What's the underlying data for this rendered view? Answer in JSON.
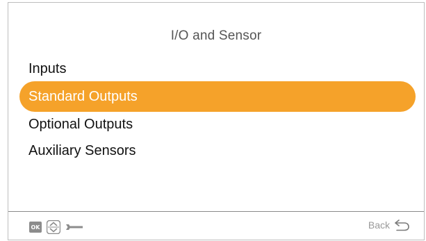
{
  "header": {
    "title": "I/O and Sensor"
  },
  "menu": {
    "items": [
      {
        "label": "Inputs",
        "selected": false
      },
      {
        "label": "Standard Outputs",
        "selected": true
      },
      {
        "label": "Optional Outputs",
        "selected": false
      },
      {
        "label": "Auxiliary Sensors",
        "selected": false
      }
    ]
  },
  "footer": {
    "ok_label": "OK",
    "back_label": "Back",
    "icons": [
      "ok-icon",
      "up-down-arrows-icon",
      "wrench-icon",
      "back-arrow-icon"
    ]
  },
  "colors": {
    "selection_highlight": "#f5a22a",
    "title_text": "#555555",
    "item_text": "#111111",
    "selected_text": "#ffffff",
    "footer_icon": "#8c8c8c"
  }
}
